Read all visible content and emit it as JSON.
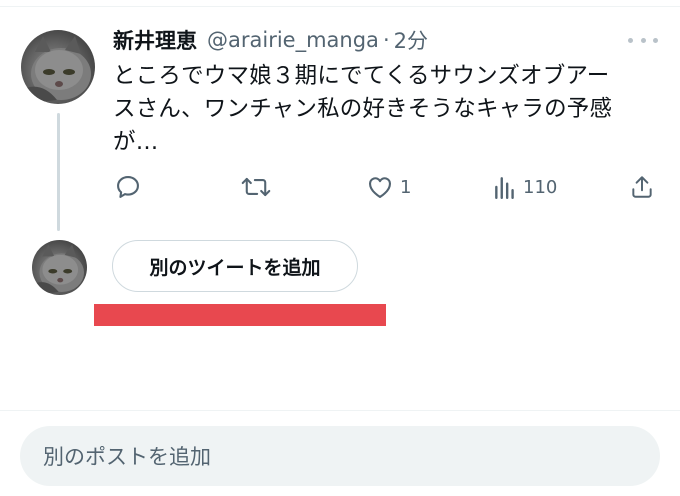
{
  "tweet": {
    "display_name": "新井理恵",
    "handle": "@arairie_manga",
    "separator": "·",
    "time": "2分",
    "text_line1": "ところでウマ娘３期にでてくるサウンズオブアー",
    "text_line2": "スさん、ワンチャン私の好きそうなキャラの予感",
    "text_line3": "が…",
    "actions": {
      "reply_icon": "reply-icon",
      "retweet_icon": "retweet-icon",
      "like_icon": "heart-icon",
      "like_count": "1",
      "views_icon": "bar-chart-icon",
      "views_count": "110",
      "share_icon": "share-icon"
    }
  },
  "thread": {
    "add_tweet_label": "別のツイートを追加"
  },
  "composer": {
    "placeholder": "別のポストを追加"
  },
  "colors": {
    "text_primary": "#0f1419",
    "text_secondary": "#536471",
    "border": "#cfd9de",
    "redaction": "#e8484f",
    "compose_bg": "#eff3f4"
  }
}
